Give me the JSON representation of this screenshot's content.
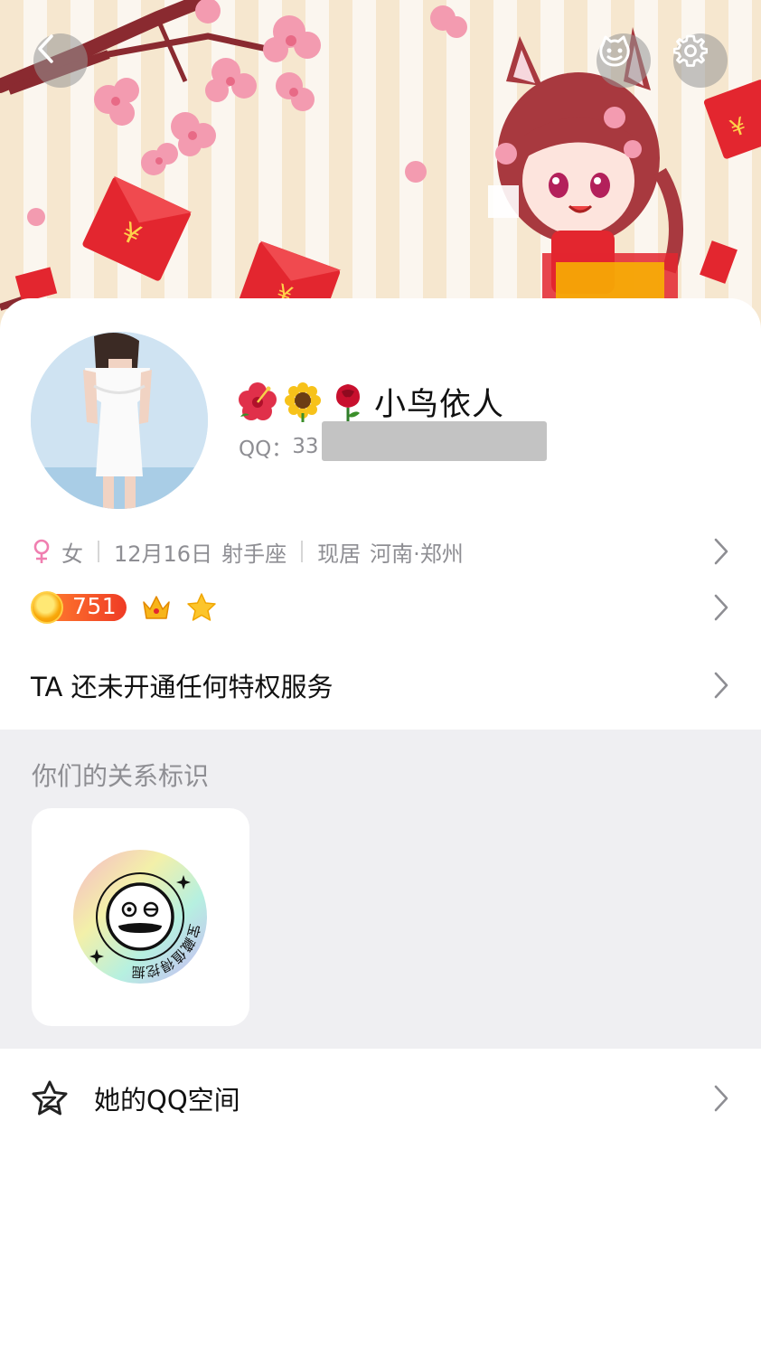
{
  "header": {
    "back_icon": "chevron-left-icon",
    "pet_icon": "pet-face-icon",
    "settings_icon": "gear-icon"
  },
  "profile": {
    "nickname_emojis": [
      "hibiscus",
      "sunflower",
      "rose"
    ],
    "nickname": "小鸟依人",
    "qq_label": "QQ：",
    "qq_visible": "33"
  },
  "info": {
    "gender_icon": "female-icon",
    "gender": "女",
    "birthday": "12月16日",
    "zodiac": "射手座",
    "location_label": "现居",
    "location": "河南·郑州"
  },
  "badges": {
    "level": "751",
    "icons": [
      "crown-icon",
      "star-icon"
    ]
  },
  "privilege": {
    "text": "TA 还未开通任何特权服务"
  },
  "relation": {
    "title": "你们的关系标识",
    "badge_text": "宝藏值得挖掘"
  },
  "qzone": {
    "icon": "qzone-star-icon",
    "label": "她的QQ空间"
  },
  "colors": {
    "accent_pink": "#f07fb0",
    "badge_orange": "#f05a24",
    "section_gray": "#efeff2",
    "text_secondary": "#8e8e93"
  }
}
